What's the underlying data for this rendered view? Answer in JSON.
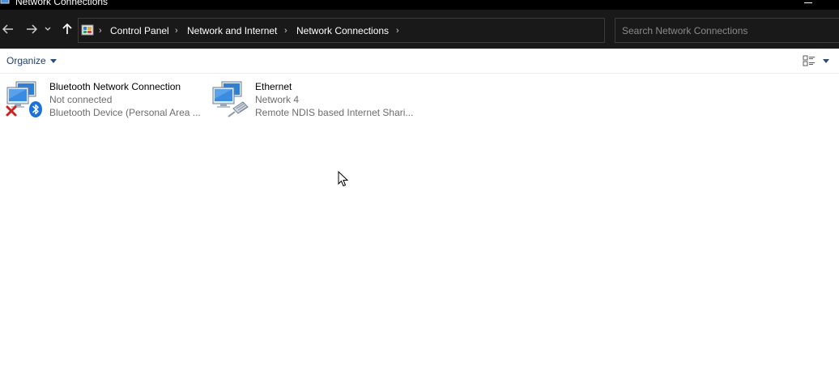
{
  "window": {
    "title": "Network Connections",
    "app_icon": "network-connections-icon"
  },
  "nav": {
    "back_icon": "arrow-left-icon",
    "forward_icon": "arrow-right-icon",
    "recent_icon": "chevron-down-icon",
    "up_icon": "arrow-up-icon"
  },
  "address": {
    "breadcrumbs": [
      "Control Panel",
      "Network and Internet",
      "Network Connections"
    ],
    "refresh_icon": "refresh-icon"
  },
  "search": {
    "placeholder": "Search Network Connections",
    "value": ""
  },
  "toolbar": {
    "organize_label": "Organize"
  },
  "connections": [
    {
      "name": "Bluetooth Network Connection",
      "status": "Not connected",
      "device": "Bluetooth Device (Personal Area ...",
      "icon": "bluetooth-network-icon",
      "badge": "disconnected-x-icon"
    },
    {
      "name": "Ethernet",
      "status": "Network 4",
      "device": "Remote NDIS based Internet Shari...",
      "icon": "ethernet-network-icon"
    }
  ],
  "colors": {
    "dark_bg": "#191919",
    "title_bg": "#000000",
    "link_blue": "#1e3f73",
    "secondary_text": "#6d6d6d"
  }
}
